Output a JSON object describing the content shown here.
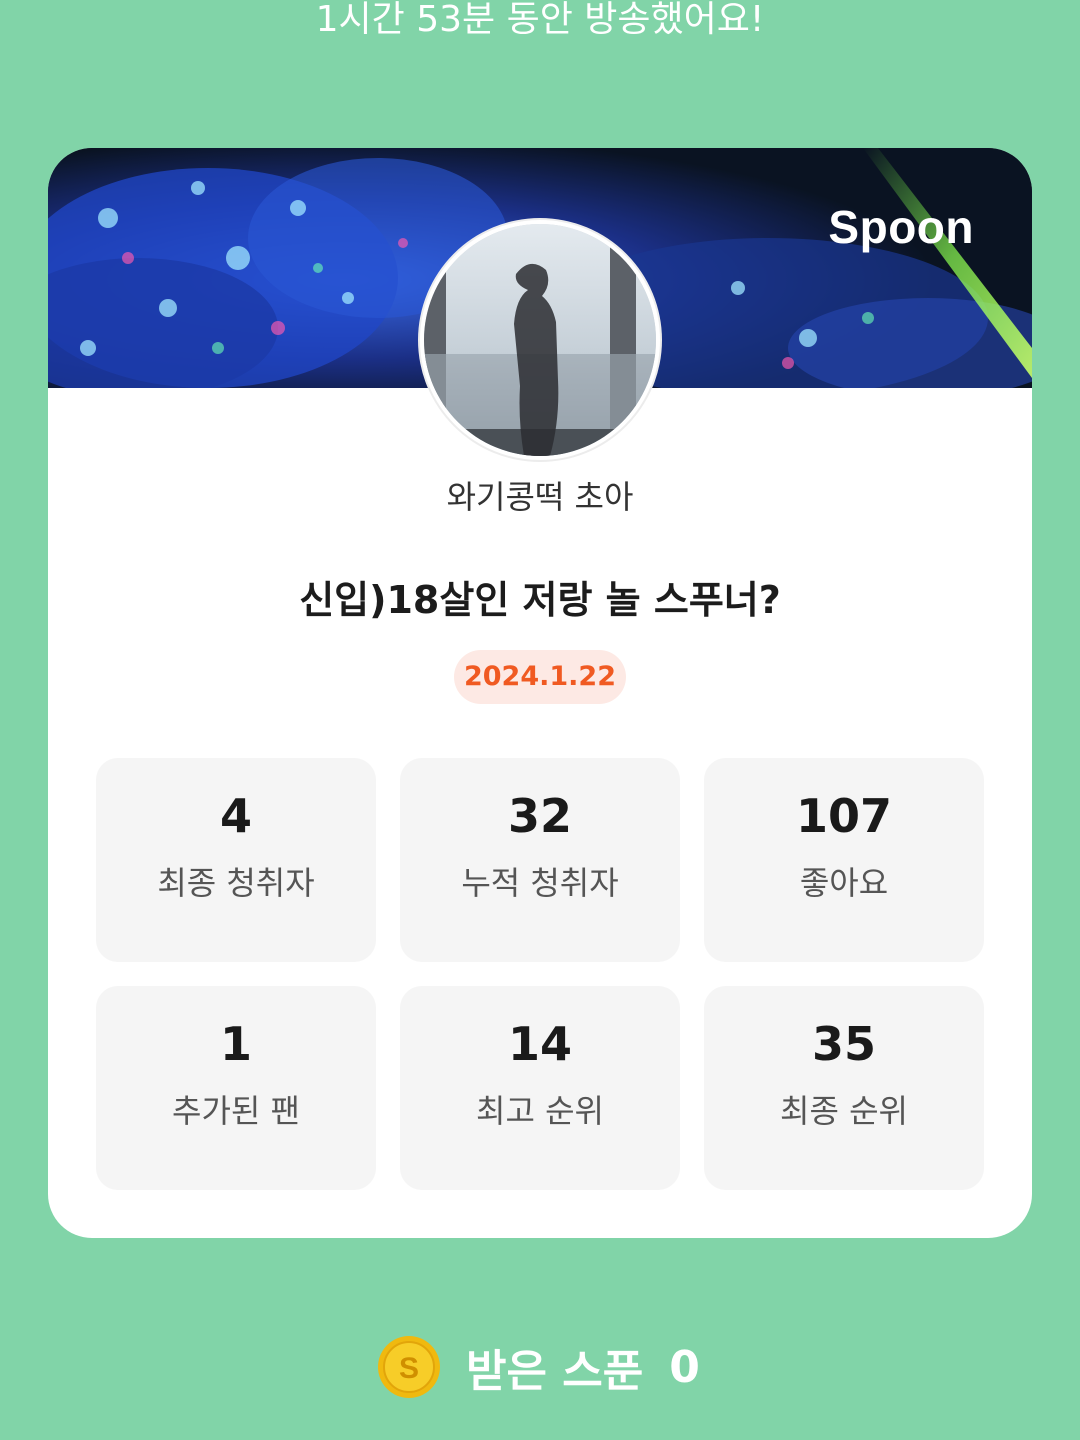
{
  "summary": "1시간 53분 동안 방송했어요!",
  "card": {
    "brand": "Spoon",
    "nickname": "와기콩떡 초아",
    "title": "신입)18살인 저랑 놀 스푸너?",
    "date": "2024.1.22"
  },
  "stats": [
    {
      "value": "4",
      "label": "최종 청취자"
    },
    {
      "value": "32",
      "label": "누적 청취자"
    },
    {
      "value": "107",
      "label": "좋아요"
    },
    {
      "value": "1",
      "label": "추가된 팬"
    },
    {
      "value": "14",
      "label": "최고 순위"
    },
    {
      "value": "35",
      "label": "최종 순위"
    }
  ],
  "received": {
    "label": "받은 스푼",
    "count": "0",
    "coin_glyph": "S"
  },
  "colors": {
    "background": "#81d4a8",
    "card": "#ffffff",
    "stat_tile": "#f5f5f5",
    "date_text": "#f05a22",
    "date_pill": "#fde9e4",
    "coin": "#f5c518"
  },
  "icons": [
    "spoon-coin-icon"
  ]
}
